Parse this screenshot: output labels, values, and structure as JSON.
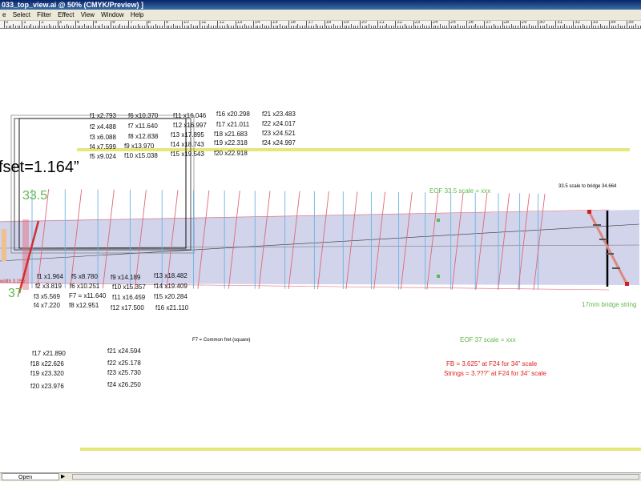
{
  "window": {
    "title": "033_top_view.ai @ 50% (CMYK/Preview) ]"
  },
  "menu": [
    "e",
    "Select",
    "Filter",
    "Effect",
    "View",
    "Window",
    "Help"
  ],
  "ruler_labels": [
    "0",
    "1",
    "2",
    "3",
    "4",
    "5",
    "6",
    "7",
    "8",
    "9",
    "10",
    "11",
    "12",
    "13",
    "14",
    "15",
    "16",
    "17",
    "18",
    "19",
    "20",
    "21",
    "22",
    "23",
    "24",
    "25",
    "26",
    "27",
    "28",
    "29",
    "30",
    "31",
    "32",
    "33",
    "34",
    "35",
    "36"
  ],
  "drawing": {
    "top_offset_label": "fset=1.164”",
    "scale_33_5": "33.5",
    "scale_37": "37",
    "width_label": "width 3.150",
    "eof_33_5": "EOF 33.5 scale = xxx",
    "eof_37": "EOF 37 scale = xxx",
    "bridge_33_5": "33.5 scale to bridge 34.664",
    "bridge_strings": "17mm bridge string",
    "common_fret": "F7 = Common fret (square)",
    "fb_note": "FB = 3.625” at F24 for 34” scale",
    "strings_note": "Strings = 3.???” at F24 for 34” scale",
    "top_frets": [
      "f1 x2.793",
      "f2 x4.488",
      "f3 x6.088",
      "f4 x7.599",
      "f5 x9.024",
      "f6 x10.370",
      "f7 x11.640",
      "f8 x12.838",
      "f9 x13.970",
      "f10 x15.038",
      "f11 x16.046",
      "f12 x16.997",
      "f13 x17.895",
      "f14 x18.743",
      "f15 x19.543",
      "f16 x20.298",
      "f17 x21.011",
      "f18 x21.683",
      "f19 x22.318",
      "f20 x22.918",
      "f21 x23.483",
      "f22 x24.017",
      "f23 x24.521",
      "f24 x24.997"
    ],
    "bottom_frets": [
      "f1 x1.964",
      "f2 x3.819",
      "f3 x5.569",
      "f4 x7.220",
      "f5 x8.780",
      "f6 x10.251",
      "F7 = x11.640",
      "f8 x12.951",
      "f9 x14.189",
      "f10 x15.357",
      "f11 x16.459",
      "f12 x17.500",
      "f13 x18.482",
      "f14 x19.409",
      "f15 x20.284",
      "f16 x21.110",
      "f17 x21.890",
      "f18 x22.626",
      "f19 x23.320",
      "f20 x23.976",
      "f21 x24.594",
      "f22 x25.178",
      "f23 x25.730",
      "f24 x26.250"
    ]
  },
  "status": {
    "mode": "Open"
  },
  "colors": {
    "accent_yellow": "#e6e67a",
    "neck_fill": "#c9cde8",
    "fret_blue": "#6fb3e0",
    "fret_red": "#e06878",
    "label_green": "#5fb84a",
    "label_red": "#e02020",
    "title_blue": "#0a246a"
  }
}
